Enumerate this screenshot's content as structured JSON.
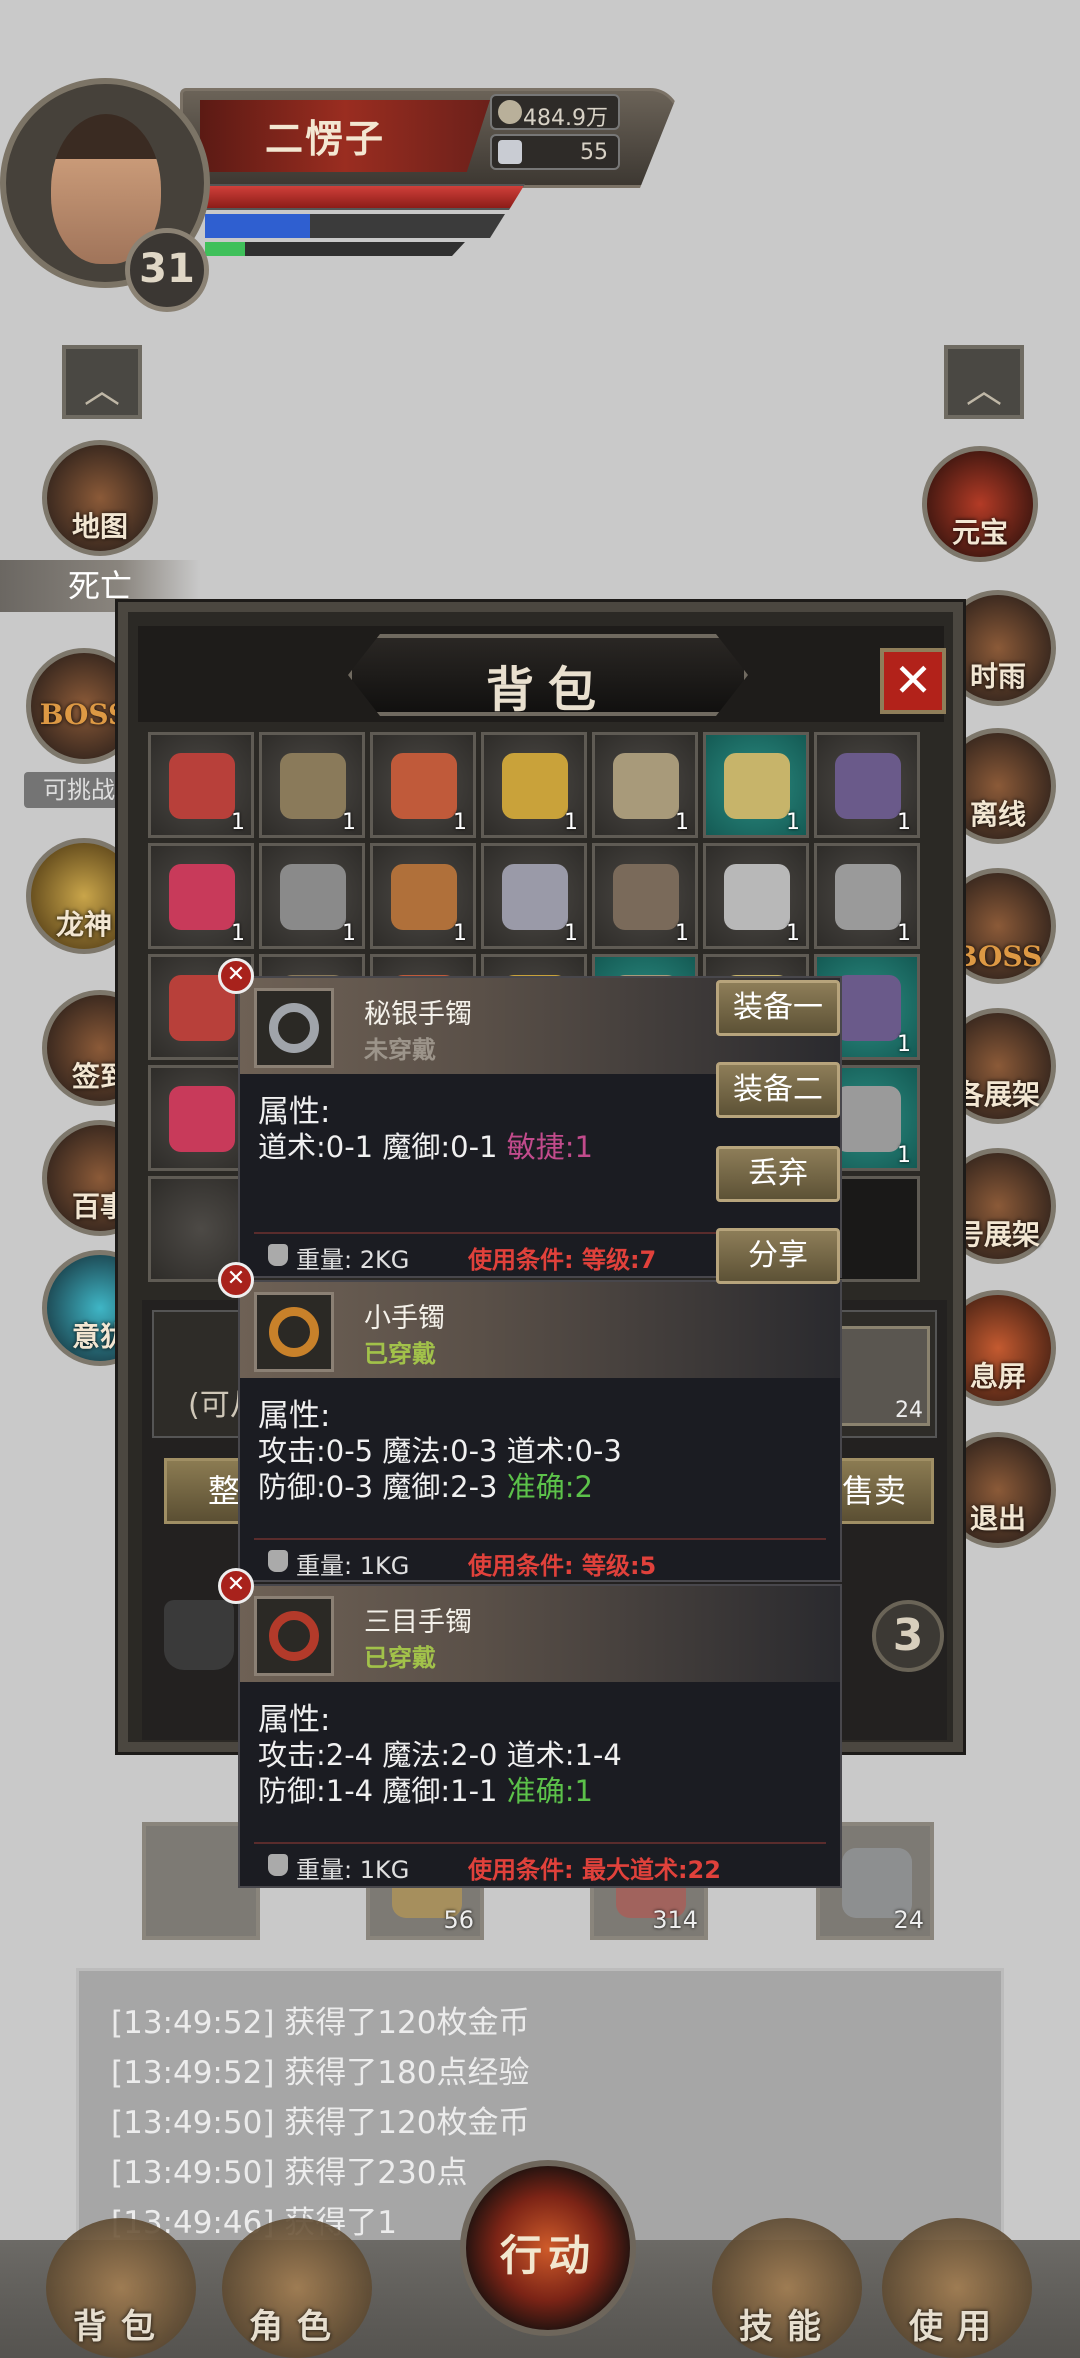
{
  "player": {
    "name": "二愣子",
    "gold": "484.9万",
    "ingot": "55",
    "level": "31"
  },
  "left_menu": {
    "map": "地图",
    "dead": "死亡",
    "boss": "BOSS",
    "challenge": "可挑战",
    "dragon": "龙神",
    "sign": "签到",
    "hundred": "百事",
    "yiyou": "意犹"
  },
  "right_menu": {
    "yuanbao": "元宝",
    "shiyu": "时雨",
    "lixian": "离线",
    "boss": "BOSS",
    "zhanjia1": "各展架",
    "zhanjia2": "号展架",
    "xiping": "息屏",
    "tuichu": "退出"
  },
  "bag": {
    "title": "背包",
    "close": "✕",
    "rows": [
      [
        "1",
        "1",
        "1",
        "1",
        "1",
        "1",
        "1"
      ],
      [
        "1",
        "1",
        "1",
        "1",
        "1",
        "1",
        "1"
      ],
      [
        "",
        "",
        "",
        "",
        "",
        "",
        "1"
      ],
      [
        "",
        "",
        "",
        "",
        "",
        "",
        "1"
      ]
    ],
    "qty_hint": "(可从",
    "left_btn": "整",
    "right_btn": "售卖",
    "round_num": "3",
    "slot_count_24": "24"
  },
  "tooltips": [
    {
      "name": "秘银手镯",
      "status": "未穿戴",
      "attr_header": "属性:",
      "line1": "道术:0-1  魔御:0-1",
      "line1_extra": "敏捷:1",
      "line2": "",
      "line2_extra": "",
      "weight": "重量: 2KG",
      "req": "使用条件: 等级:7"
    },
    {
      "name": "小手镯",
      "status": "已穿戴",
      "attr_header": "属性:",
      "line1": "攻击:0-5  魔法:0-3  道术:0-3",
      "line1_extra": "",
      "line2": "防御:0-3  魔御:2-3",
      "line2_extra": "准确:2",
      "weight": "重量: 1KG",
      "req": "使用条件: 等级:5"
    },
    {
      "name": "三目手镯",
      "status": "已穿戴",
      "attr_header": "属性:",
      "line1": "攻击:2-4  魔法:2-0  道术:1-4",
      "line1_extra": "",
      "line2": "防御:1-4  魔御:1-1",
      "line2_extra": "准确:1",
      "weight": "重量: 1KG",
      "req": "使用条件: 最大道术:22"
    }
  ],
  "actions": {
    "equip1": "装备一",
    "equip2": "装备二",
    "discard": "丢弃",
    "share": "分享"
  },
  "equip_counts": [
    "",
    "56",
    "314",
    "24"
  ],
  "log": [
    "[13:49:52] 获得了120枚金币",
    "[13:49:52] 获得了180点经验",
    "[13:49:50] 获得了120枚金币",
    "[13:49:50] 获得了230点",
    "[13:49:46] 获得了1"
  ],
  "nav": {
    "bag": "背包",
    "role": "角色",
    "action": "行动",
    "skill": "技能",
    "use": "使用"
  },
  "colors": {
    "accent_red": "#b2221a",
    "attr_green": "#5cc24a",
    "attr_pink": "#c24b8c",
    "req_red": "#e0413b",
    "teal_slot": "#2c8d82"
  }
}
